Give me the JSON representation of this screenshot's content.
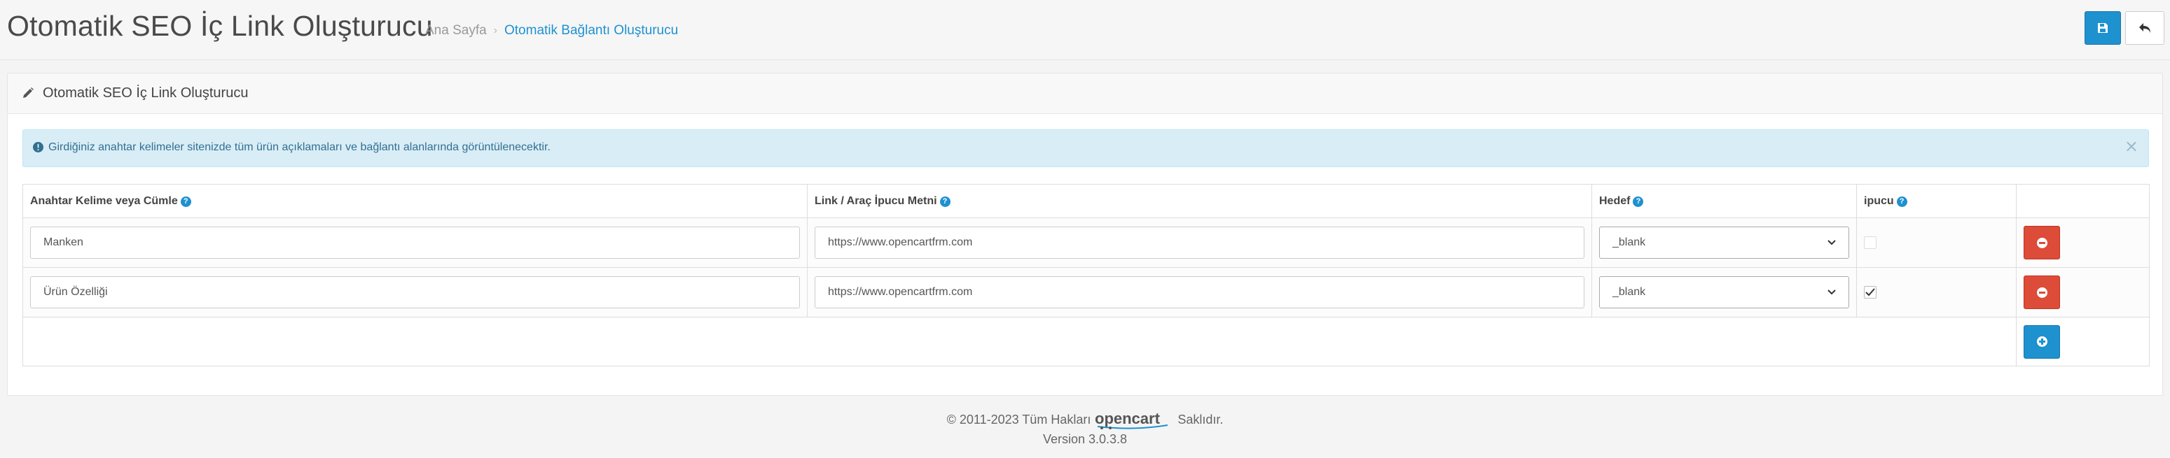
{
  "header": {
    "title": "Otomatik SEO İç Link Oluşturucu",
    "breadcrumb": {
      "home": "Ana Sayfa",
      "separator": "›",
      "current": "Otomatik Bağlantı Oluşturucu"
    }
  },
  "panel": {
    "title": "Otomatik SEO İç Link Oluşturucu"
  },
  "alert": {
    "text": "Girdiğiniz anahtar kelimeler sitenizde tüm ürün açıklamaları ve bağlantı alanlarında görüntülenecektir.",
    "close": "×"
  },
  "table": {
    "columns": {
      "keyword": "Anahtar Kelime veya Cümle",
      "link": "Link / Araç İpucu Metni",
      "target": "Hedef",
      "tip": "ipucu"
    },
    "rows": [
      {
        "keyword": "Manken",
        "link": "https://www.opencartfrm.com",
        "target": "_blank",
        "tip_checked": false
      },
      {
        "keyword": "Ürün Özelliği",
        "link": "https://www.opencartfrm.com",
        "target": "_blank",
        "tip_checked": true
      }
    ]
  },
  "footer": {
    "copyright_left": "© 2011-2023 Tüm Hakları",
    "logo_text": "opencart",
    "copyright_right": "Saklıdır.",
    "version": "Version 3.0.3.8"
  },
  "colors": {
    "primary": "#1e91cf",
    "danger": "#dd4b39",
    "info_bg": "#d9edf7"
  }
}
